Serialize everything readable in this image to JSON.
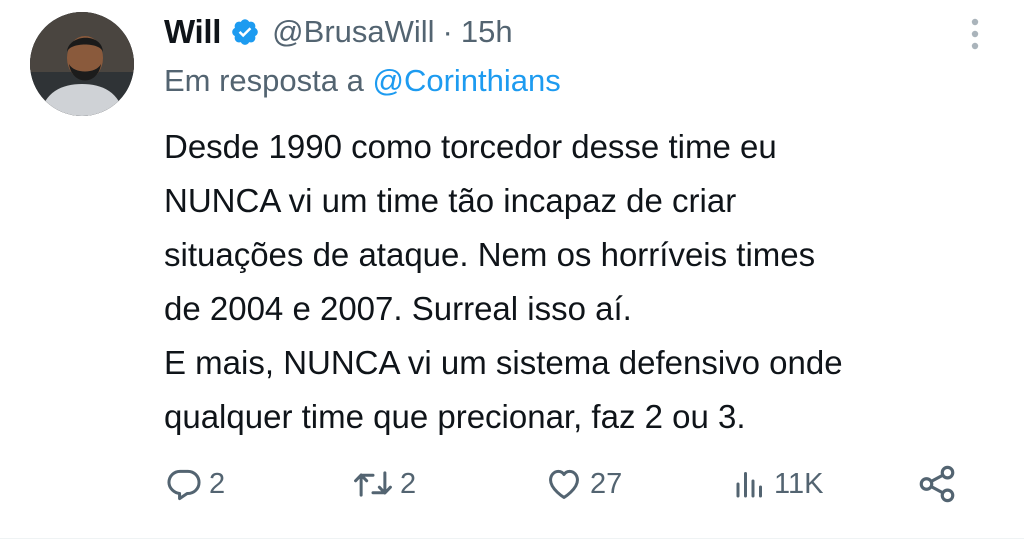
{
  "user": {
    "display_name": "Will",
    "handle": "@BrusaWill",
    "separator": "·",
    "time": "15h"
  },
  "reply": {
    "prefix": "Em resposta a",
    "mention": "@Corinthians"
  },
  "tweet": {
    "lines": [
      "Desde 1990 como torcedor desse time eu",
      "NUNCA vi um time tão incapaz de criar",
      "situações de ataque. Nem os horríveis times",
      "de 2004 e 2007. Surreal isso aí.",
      "E mais, NUNCA vi um sistema defensivo onde",
      "qualquer time que precionar, faz 2 ou 3."
    ]
  },
  "actions": {
    "replies": "2",
    "retweets": "2",
    "likes": "27",
    "views": "11K"
  },
  "icons": {
    "verified": "verified-badge-icon",
    "more": "more-vertical-icon",
    "reply": "reply-icon",
    "retweet": "retweet-icon",
    "like": "heart-icon",
    "views": "views-icon",
    "share": "share-icon"
  },
  "colors": {
    "text": "#0f1419",
    "secondary": "#536471",
    "accent": "#1d9bf0"
  }
}
